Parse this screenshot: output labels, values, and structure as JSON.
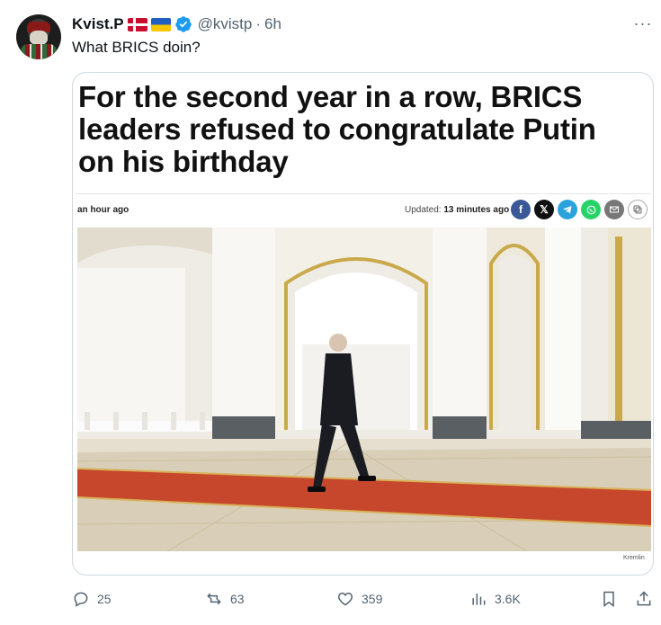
{
  "tweet": {
    "author_name": "Kvist.P",
    "handle": "@kvistp",
    "separator": "·",
    "time": "6h",
    "text": "What BRICS doin?",
    "more_icon": "···"
  },
  "card": {
    "headline": "For the second year in a row, BRICS leaders refused to congratulate Putin on his birthday",
    "posted": "an hour ago",
    "updated_label": "Updated:",
    "updated_value": "13 minutes ago",
    "share_icons": [
      "facebook-icon",
      "x-icon",
      "telegram-icon",
      "whatsapp-icon",
      "mail-icon",
      "copy-icon"
    ],
    "photo_credit": "Kremlin"
  },
  "actions": {
    "replies": "25",
    "reposts": "63",
    "likes": "359",
    "views": "3.6K"
  },
  "colors": {
    "text": "#0f1419",
    "muted": "#536471",
    "verified": "#1d9bf0",
    "border": "#cfd9de",
    "carpet": "#c6472c"
  }
}
